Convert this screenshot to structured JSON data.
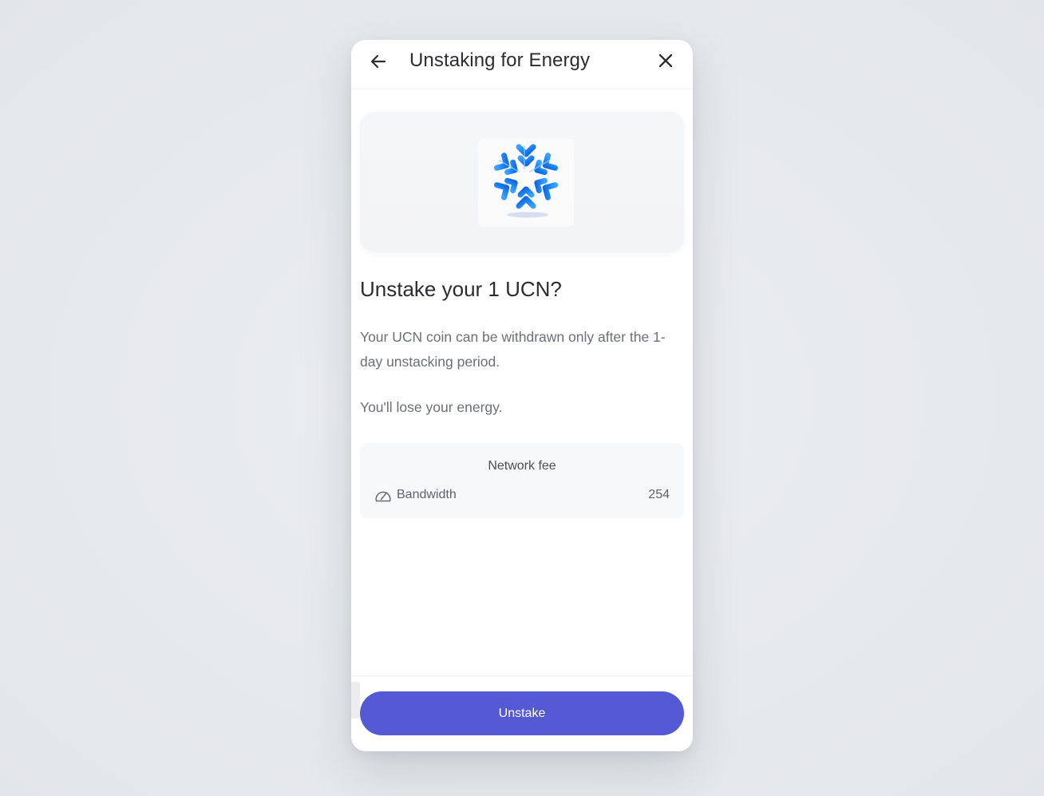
{
  "header": {
    "title": "Unstaking for Energy",
    "back_icon": "arrow-left-icon",
    "close_icon": "close-icon"
  },
  "hero": {
    "icon": "snowflake-icon",
    "accent_color": "#1a7ef0"
  },
  "main": {
    "heading": "Unstake your 1 UCN?",
    "description": "Your UCN coin can be withdrawn only after the 1-day unstacking period.",
    "warning": "You'll lose your energy."
  },
  "network_fee": {
    "title": "Network fee",
    "rows": [
      {
        "icon": "gauge-icon",
        "label": "Bandwidth",
        "value": "254"
      }
    ]
  },
  "footer": {
    "unstake_label": "Unstake",
    "button_color": "#5459d4"
  }
}
